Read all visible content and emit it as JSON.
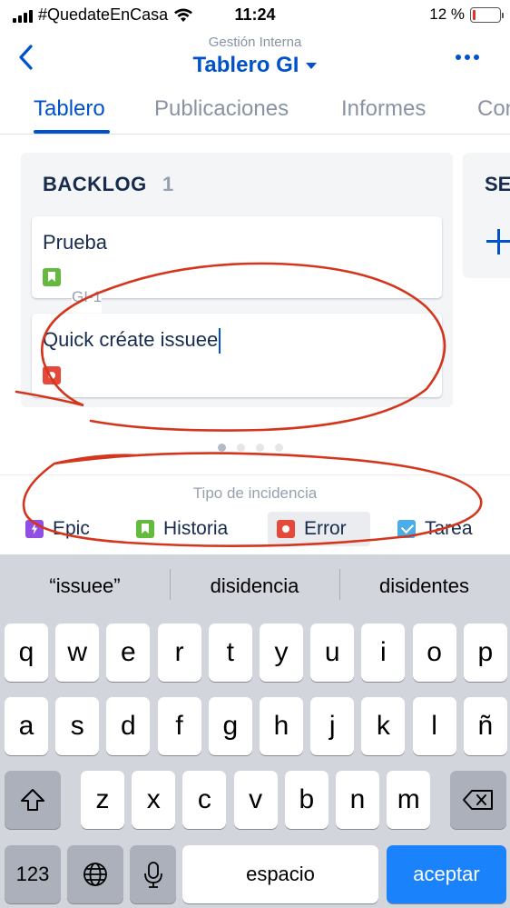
{
  "status_bar": {
    "carrier": "#QuedateEnCasa",
    "time": "11:24",
    "battery_percent": "12 %",
    "battery_level": 0.12
  },
  "header": {
    "subtitle": "Gestión Interna",
    "title": "Tablero GI"
  },
  "tabs": [
    {
      "label": "Tablero",
      "active": true
    },
    {
      "label": "Publicaciones",
      "active": false
    },
    {
      "label": "Informes",
      "active": false
    },
    {
      "label": "Con",
      "active": false
    }
  ],
  "board": {
    "column1": {
      "title": "BACKLOG",
      "count": "1",
      "cards": [
        {
          "summary": "Prueba",
          "key": "GI-1",
          "icon": "story-icon"
        },
        {
          "summary": "Quick créate issuee",
          "key": "",
          "icon": "bug-icon"
        }
      ]
    },
    "column2": {
      "title": "SE"
    }
  },
  "issue_types": {
    "label": "Tipo de incidencia",
    "options": [
      {
        "label": "Epic",
        "icon": "epic-icon"
      },
      {
        "label": "Historia",
        "icon": "story-icon"
      },
      {
        "label": "Error",
        "icon": "bug-icon",
        "selected": true
      },
      {
        "label": "Tarea",
        "icon": "task-icon"
      }
    ]
  },
  "keyboard": {
    "suggestions": [
      "“issuee”",
      "disidencia",
      "disidentes"
    ],
    "row1": [
      "q",
      "w",
      "e",
      "r",
      "t",
      "y",
      "u",
      "i",
      "o",
      "p"
    ],
    "row2": [
      "a",
      "s",
      "d",
      "f",
      "g",
      "h",
      "j",
      "k",
      "l",
      "ñ"
    ],
    "row3": [
      "z",
      "x",
      "c",
      "v",
      "b",
      "n",
      "m"
    ],
    "numbers_key": "123",
    "space_key": "espacio",
    "accept_key": "aceptar"
  },
  "colors": {
    "accent": "#0052cc",
    "accept_key": "#1a82fb",
    "bug": "#e5493a",
    "story": "#63ba3c",
    "epic": "#904ee2",
    "task": "#4bade8"
  }
}
